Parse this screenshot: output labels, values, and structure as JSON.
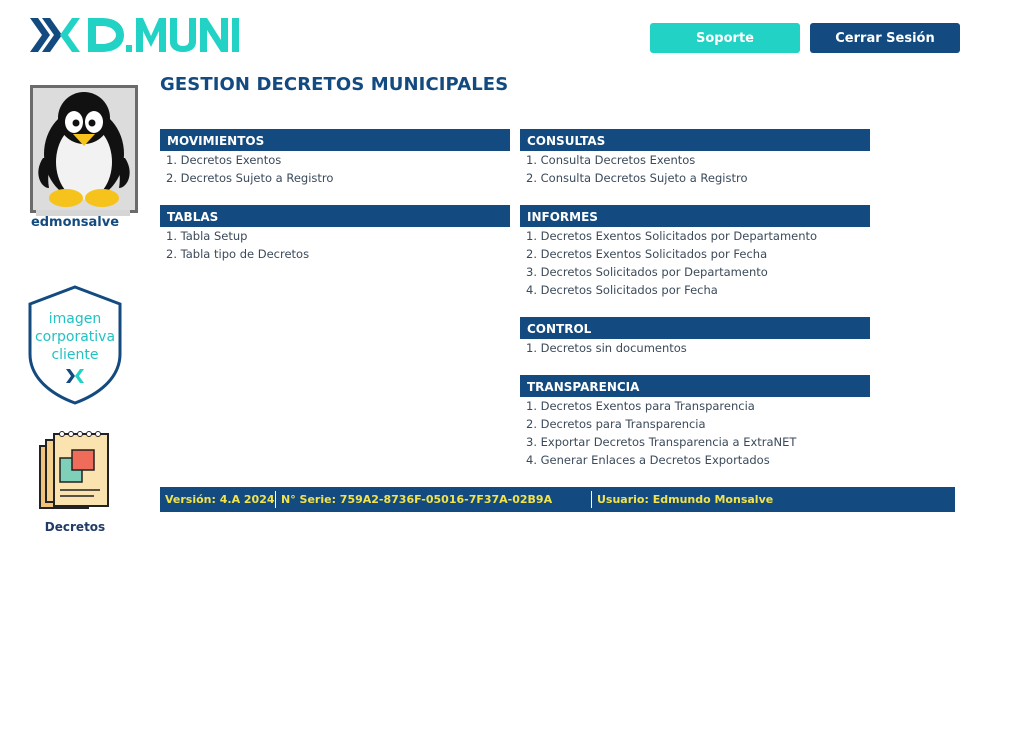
{
  "brand": {
    "logo_text": "EDMUNI",
    "colors": {
      "navy": "#134b80",
      "teal": "#22d3c5",
      "yellow": "#f3e34a"
    }
  },
  "header": {
    "support_label": "Soporte",
    "logout_label": "Cerrar Sesión"
  },
  "sidebar": {
    "avatar_icon": "penguin-avatar",
    "username": "edmonsalve",
    "badge_lines": [
      "imagen",
      "corporativa",
      "cliente"
    ],
    "app_icon": "documents-icon",
    "app_label": "Decretos"
  },
  "page_title": "GESTION DECRETOS MUNICIPALES",
  "sections": {
    "movimientos": {
      "title": "MOVIMIENTOS",
      "items": [
        "1. Decretos Exentos",
        "2. Decretos Sujeto a Registro"
      ]
    },
    "consultas": {
      "title": "CONSULTAS",
      "items": [
        "1. Consulta Decretos Exentos",
        "2. Consulta Decretos Sujeto a Registro"
      ]
    },
    "tablas": {
      "title": "TABLAS",
      "items": [
        "1. Tabla Setup",
        "2. Tabla tipo de Decretos"
      ]
    },
    "informes": {
      "title": "INFORMES",
      "items": [
        "1. Decretos Exentos Solicitados por Departamento",
        "2. Decretos Exentos Solicitados por Fecha",
        "3. Decretos Solicitados por Departamento",
        "4. Decretos Solicitados por Fecha"
      ]
    },
    "control": {
      "title": "CONTROL",
      "items": [
        "1. Decretos sin documentos"
      ]
    },
    "transparencia": {
      "title": "TRANSPARENCIA",
      "items": [
        "1. Decretos Exentos para Transparencia",
        "2. Decretos para Transparencia",
        "3. Exportar Decretos Transparencia a ExtraNET",
        "4. Generar Enlaces a Decretos Exportados"
      ]
    }
  },
  "footer": {
    "version": "Versión: 4.A 2024",
    "serial": "N° Serie: 759A2-8736F-05016-7F37A-02B9A",
    "user": "Usuario: Edmundo Monsalve"
  }
}
